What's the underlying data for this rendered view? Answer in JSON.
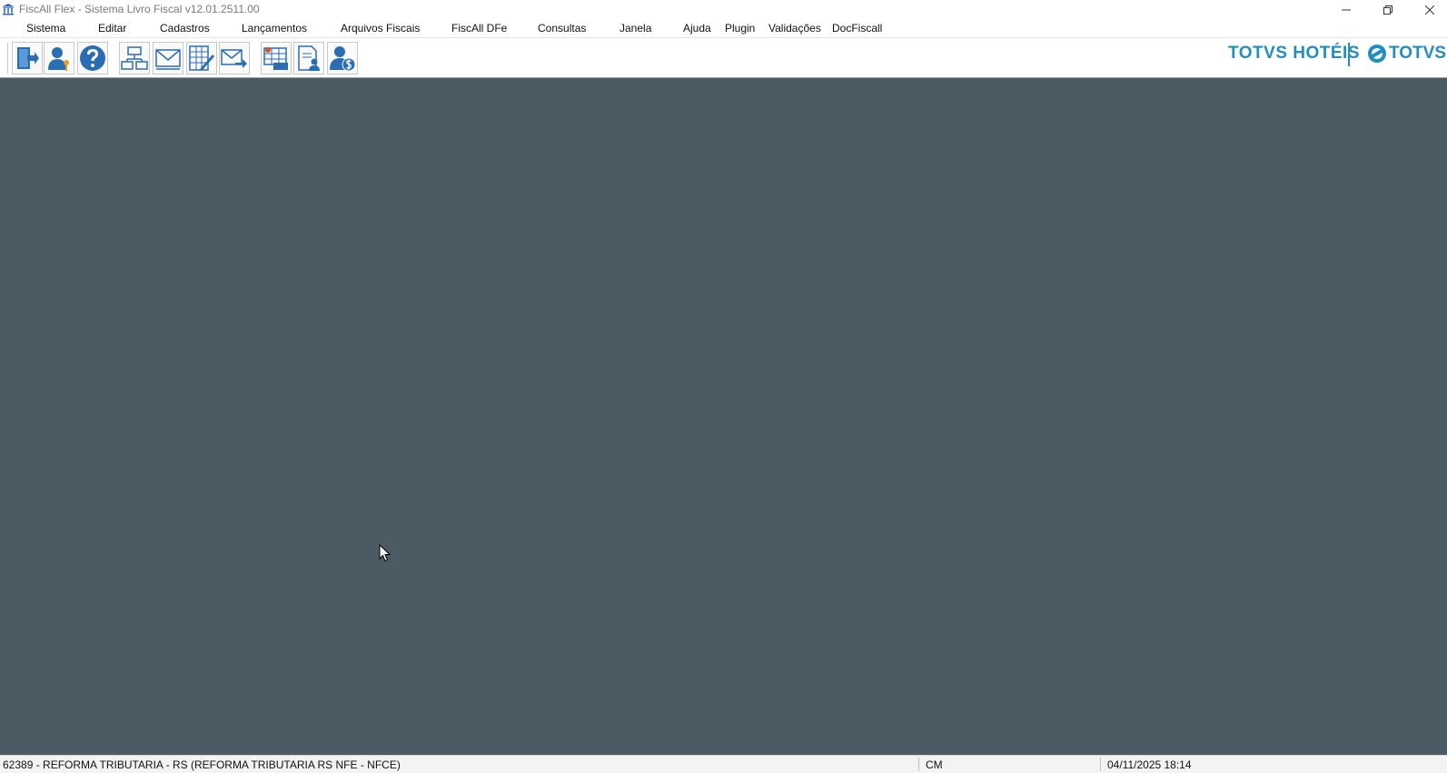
{
  "window": {
    "title": "FiscAll Flex - Sistema Livro Fiscal v12.01.2511.00",
    "icon": "bank-icon"
  },
  "menu": {
    "items": [
      {
        "label": "Sistema"
      },
      {
        "label": "Editar"
      },
      {
        "label": "Cadastros"
      },
      {
        "label": "Lançamentos"
      },
      {
        "label": "Arquivos Fiscais"
      },
      {
        "label": "FiscAll DFe"
      },
      {
        "label": "Consultas"
      },
      {
        "label": "Janela"
      },
      {
        "label": "Ajuda"
      },
      {
        "label": "Plugin"
      },
      {
        "label": "Validações"
      },
      {
        "label": "DocFiscall"
      }
    ]
  },
  "toolbar": {
    "buttons": [
      {
        "icon": "exit-door-icon"
      },
      {
        "icon": "user-key-icon"
      },
      {
        "icon": "help-icon"
      },
      {
        "icon": "org-chart-icon"
      },
      {
        "icon": "envelope-icon"
      },
      {
        "icon": "spreadsheet-edit-icon"
      },
      {
        "icon": "send-mail-icon"
      },
      {
        "icon": "icms-table-icon"
      },
      {
        "icon": "document-user-icon"
      },
      {
        "icon": "user-money-icon"
      }
    ]
  },
  "branding": {
    "product": "TOTVS HOTÉIS",
    "company": "TOTVS",
    "color": "#1f8fc0"
  },
  "workspace": {
    "background": "#4b5a63"
  },
  "statusbar": {
    "company": "62389 - REFORMA TRIBUTARIA - RS (REFORMA TRIBUTARIA RS NFE - NFCE)",
    "mode": "CM",
    "datetime": "04/11/2025 18:14"
  }
}
